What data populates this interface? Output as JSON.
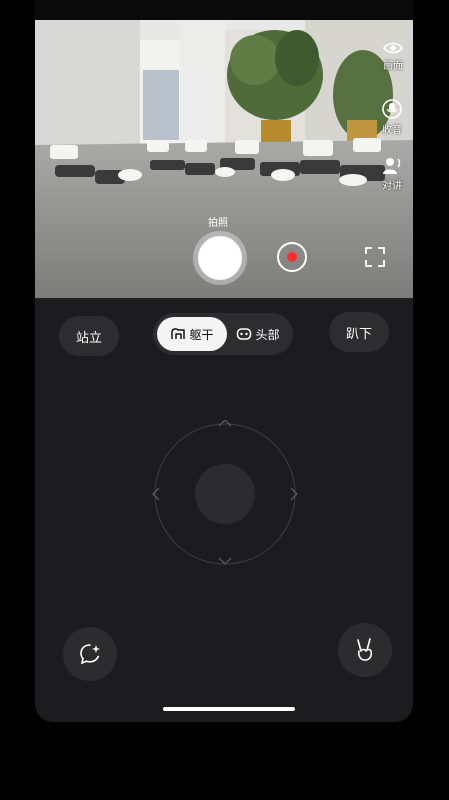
{
  "camera": {
    "controls": [
      {
        "label": "画面",
        "icon": "eye-icon"
      },
      {
        "label": "收音",
        "icon": "microphone-icon"
      },
      {
        "label": "对讲",
        "icon": "intercom-icon"
      }
    ],
    "shutter_label": "拍照"
  },
  "posture": {
    "stand_label": "站立",
    "lie_down_label": "趴下"
  },
  "mode_toggle": {
    "options": [
      {
        "label": "躯干",
        "icon": "robot-body-icon",
        "active": true
      },
      {
        "label": "头部",
        "icon": "robot-head-icon",
        "active": false
      }
    ]
  },
  "joystick": {
    "arrows": [
      "chevron-up-icon",
      "chevron-right-icon",
      "chevron-down-icon",
      "chevron-left-icon"
    ]
  },
  "bottom": {
    "left_icon": "chat-sparkle-icon",
    "right_icon": "victory-hand-icon"
  },
  "colors": {
    "panel": "#1c1c1e",
    "button": "#2d2d30",
    "record": "#ff2d2d"
  }
}
